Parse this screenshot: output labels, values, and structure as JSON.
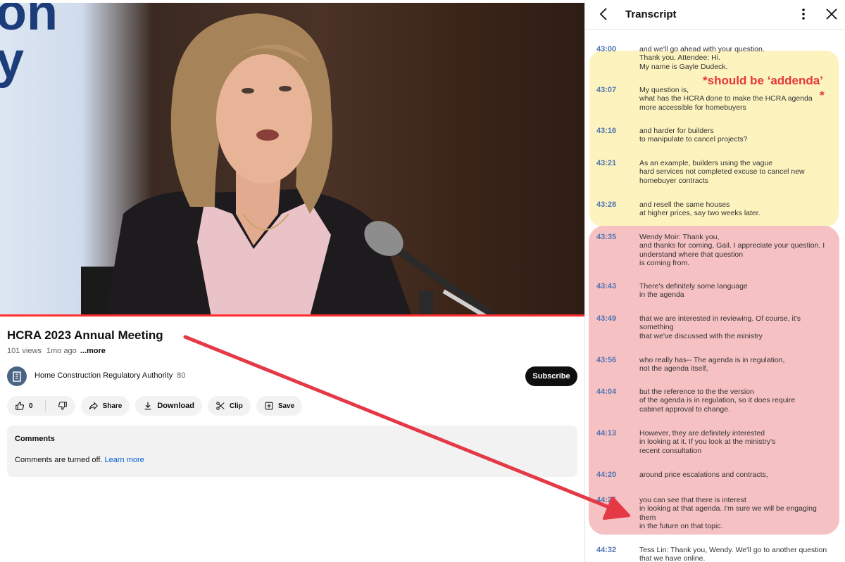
{
  "video": {
    "bg_logo_line1": "on",
    "bg_logo_line2": "y",
    "progress_fraction": 1.0
  },
  "title": "HCRA 2023 Annual Meeting",
  "meta": {
    "views": "101 views",
    "age": "1mo ago",
    "more": "...more"
  },
  "channel": {
    "name": "Home Construction Regulatory Authority",
    "subscribers": "80",
    "subscribe_label": "Subscribe"
  },
  "actions": {
    "like_count": "0",
    "share": "Share",
    "download": "Download",
    "clip": "Clip",
    "save": "Save"
  },
  "comments": {
    "title": "Comments",
    "text": "Comments are turned off.",
    "link": "Learn more"
  },
  "transcript": {
    "title": "Transcript",
    "annotation": "*should be ‘addenda’",
    "annotation_asterisk": "*",
    "segments": [
      {
        "time": "43:00",
        "text": "and we'll go ahead with your question.\nThank you. Attendee: Hi.\nMy name is Gayle Dudeck."
      },
      {
        "time": "43:07",
        "text": "My question is,\nwhat has the HCRA done to make the HCRA agenda\nmore accessible for homebuyers"
      },
      {
        "time": "43:16",
        "text": "and harder for builders\nto manipulate to cancel projects?"
      },
      {
        "time": "43:21",
        "text": "As an example, builders using the vague\nhard services not completed excuse to cancel new\nhomebuyer contracts"
      },
      {
        "time": "43:28",
        "text": "and resell the same houses\nat higher prices, say two weeks later."
      },
      {
        "time": "43:35",
        "text": "Wendy Moir: Thank you,\nand thanks for coming, Gail. I appreciate your question. I\nunderstand where that question\nis coming from."
      },
      {
        "time": "43:43",
        "text": "There's definitely some language\nin the agenda"
      },
      {
        "time": "43:49",
        "text": "that we are interested in reviewing. Of course, it's\nsomething\nthat we've discussed with the ministry"
      },
      {
        "time": "43:56",
        "text": "who really has-- The agenda is in regulation,\nnot the agenda itself,"
      },
      {
        "time": "44:04",
        "text": "but the reference to the the version\nof the agenda is in regulation, so it does require\ncabinet approval to change."
      },
      {
        "time": "44:13",
        "text": "However, they are definitely interested\nin looking at it. If you look at the ministry's\nrecent consultation"
      },
      {
        "time": "44:20",
        "text": "around price escalations and contracts,"
      },
      {
        "time": "44:25",
        "text": "you can see that there is interest\nin looking at that agenda. I'm sure we will be engaging\nthem\nin the future on that topic."
      },
      {
        "time": "44:32",
        "text": "Tess Lin: Thank you, Wendy. We'll go to another question\nthat we have online."
      }
    ]
  },
  "colors": {
    "accent_red": "#e53935",
    "timestamp_blue": "#4f74b3",
    "highlight_yellow": "#fdf3bf",
    "highlight_red": "#f6c1c3",
    "link_blue": "#065fd4"
  }
}
